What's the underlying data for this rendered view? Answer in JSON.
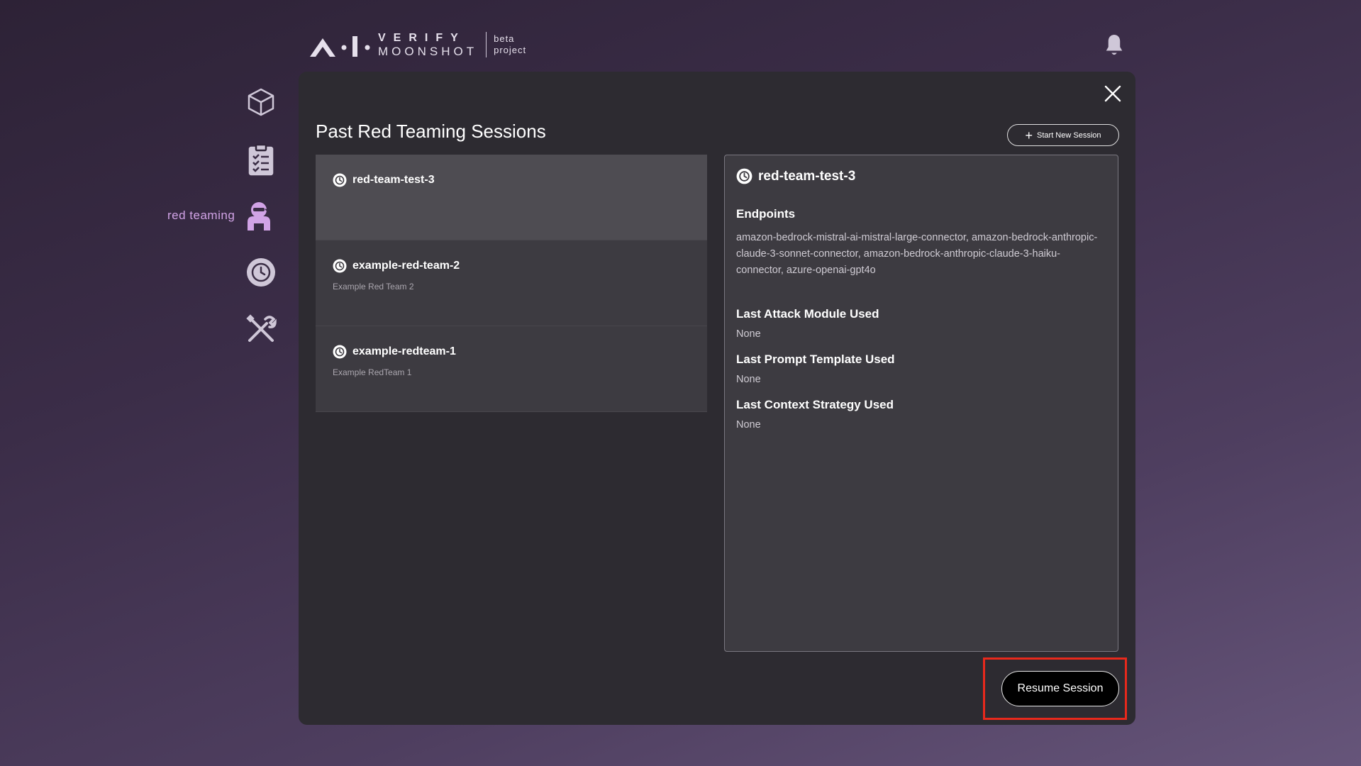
{
  "header": {
    "logo_line1": "VERIFY",
    "logo_line2": "MOONSHOT",
    "logo_beta": "beta",
    "logo_project": "project",
    "bell_icon": "bell-icon"
  },
  "sidebar": {
    "items": [
      {
        "icon": "cube-icon",
        "label": ""
      },
      {
        "icon": "clipboard-checklist-icon",
        "label": ""
      },
      {
        "icon": "red-teaming-agent-icon",
        "label": "red teaming",
        "active": true
      },
      {
        "icon": "history-clock-icon",
        "label": ""
      },
      {
        "icon": "tools-icon",
        "label": ""
      }
    ],
    "active_color": "#d1a3e6",
    "icon_color": "#cfc7d8"
  },
  "modal": {
    "title": "Past Red Teaming Sessions",
    "start_new_label": "Start New Session",
    "close_icon": "close-icon",
    "sessions": [
      {
        "name": "red-team-test-3",
        "description": "",
        "selected": true
      },
      {
        "name": "example-red-team-2",
        "description": "Example Red Team 2",
        "selected": false
      },
      {
        "name": "example-redteam-1",
        "description": "Example RedTeam 1",
        "selected": false
      }
    ],
    "detail": {
      "name": "red-team-test-3",
      "endpoints_heading": "Endpoints",
      "endpoints": "amazon-bedrock-mistral-ai-mistral-large-connector, amazon-bedrock-anthropic-claude-3-sonnet-connector, amazon-bedrock-anthropic-claude-3-haiku-connector, azure-openai-gpt4o",
      "attack_module_heading": "Last Attack Module Used",
      "attack_module_value": "None",
      "prompt_template_heading": "Last Prompt Template Used",
      "prompt_template_value": "None",
      "context_strategy_heading": "Last Context Strategy Used",
      "context_strategy_value": "None"
    },
    "resume_label": "Resume Session",
    "highlight_color": "#e8291c"
  }
}
